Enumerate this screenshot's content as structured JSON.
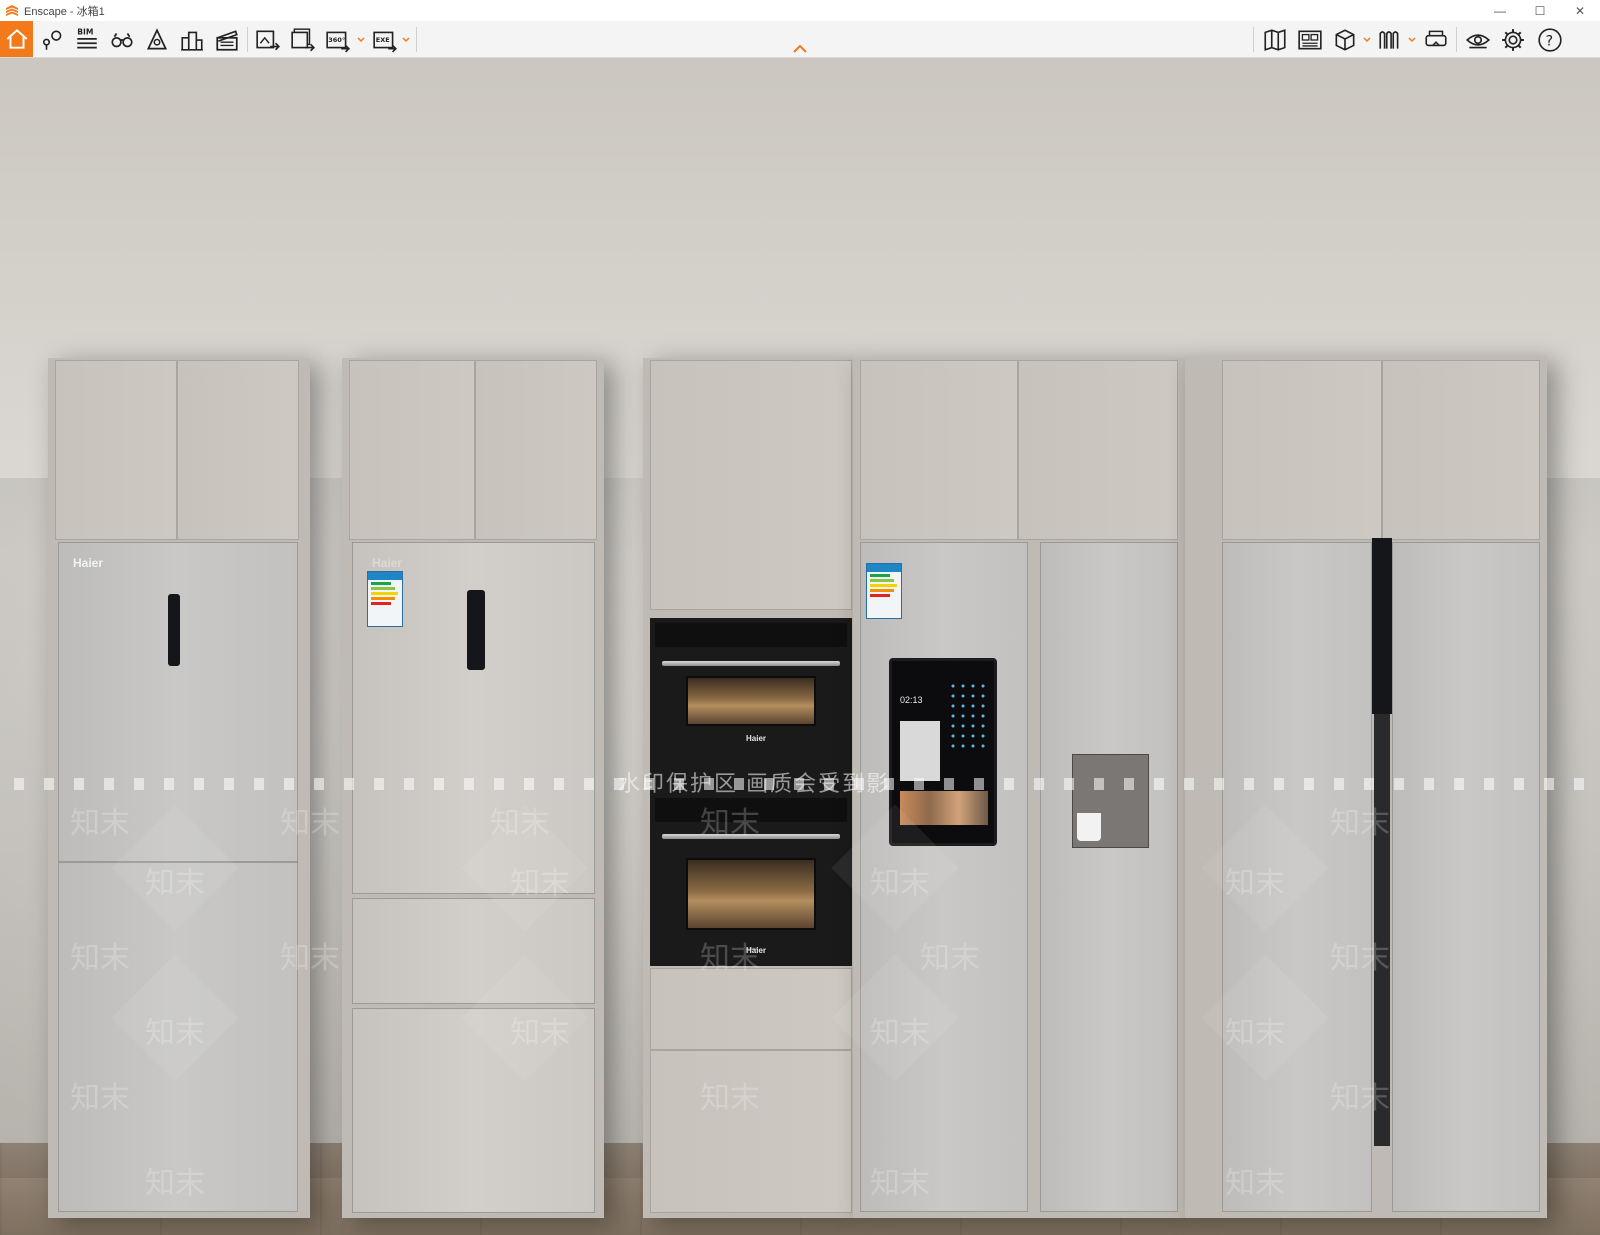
{
  "window": {
    "title": "Enscape - 冰箱1",
    "minimize": "—",
    "maximize": "☐",
    "close": "✕"
  },
  "toolbar": {
    "accent": "#f27a1a",
    "left_icons": [
      "home-icon",
      "location-pin-icon",
      "bim-icon",
      "binoculars-icon",
      "eye-level-icon",
      "buildings-icon",
      "clapperboard-icon",
      "export-image-icon",
      "batch-export-icon",
      "panorama-360-icon",
      "export-exe-icon"
    ],
    "bim_label": "BIM",
    "panorama_label": "360°",
    "exe_label": "EXE",
    "right_icons": [
      "map-icon",
      "asset-library-icon",
      "cube-view-icon",
      "material-editor-icon",
      "vr-headset-icon",
      "visual-settings-icon",
      "settings-icon",
      "help-icon"
    ],
    "help_label": "?"
  },
  "scene": {
    "brands": {
      "fridge_1": "Haier",
      "fridge_2": "Haier",
      "oven_top": "Haier",
      "oven_bottom": "Haier"
    },
    "smart_screen_time": "02:13",
    "watermark": {
      "banner": "水印保护区   画质会受到影",
      "marks": [
        "知末",
        "知末",
        "知末",
        "知末",
        "知末",
        "知末",
        "知末",
        "知末",
        "知末",
        "知末",
        "知末",
        "知末",
        "知末",
        "知末",
        "知末",
        "知末",
        "知末",
        "知末",
        "知末",
        "知末",
        "知末",
        "知末",
        "知末",
        "知末"
      ]
    }
  }
}
